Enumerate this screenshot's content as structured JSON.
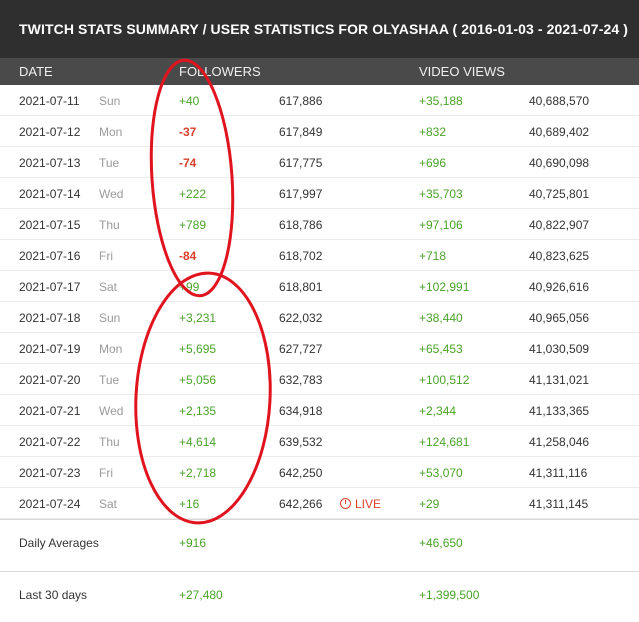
{
  "title": "TWITCH STATS SUMMARY / USER STATISTICS FOR OLYASHAA ( 2016-01-03 - 2021-07-24 )",
  "headers": {
    "date": "DATE",
    "followers": "FOLLOWERS",
    "video_views": "VIDEO VIEWS"
  },
  "rows": [
    {
      "date": "2021-07-11",
      "day": "Sun",
      "followers_change": "+40",
      "followers_total": "617,886",
      "views_change": "+35,188",
      "views_total": "40,688,570"
    },
    {
      "date": "2021-07-12",
      "day": "Mon",
      "followers_change": "-37",
      "followers_total": "617,849",
      "views_change": "+832",
      "views_total": "40,689,402"
    },
    {
      "date": "2021-07-13",
      "day": "Tue",
      "followers_change": "-74",
      "followers_total": "617,775",
      "views_change": "+696",
      "views_total": "40,690,098"
    },
    {
      "date": "2021-07-14",
      "day": "Wed",
      "followers_change": "+222",
      "followers_total": "617,997",
      "views_change": "+35,703",
      "views_total": "40,725,801"
    },
    {
      "date": "2021-07-15",
      "day": "Thu",
      "followers_change": "+789",
      "followers_total": "618,786",
      "views_change": "+97,106",
      "views_total": "40,822,907"
    },
    {
      "date": "2021-07-16",
      "day": "Fri",
      "followers_change": "-84",
      "followers_total": "618,702",
      "views_change": "+718",
      "views_total": "40,823,625"
    },
    {
      "date": "2021-07-17",
      "day": "Sat",
      "followers_change": "+99",
      "followers_total": "618,801",
      "views_change": "+102,991",
      "views_total": "40,926,616"
    },
    {
      "date": "2021-07-18",
      "day": "Sun",
      "followers_change": "+3,231",
      "followers_total": "622,032",
      "views_change": "+38,440",
      "views_total": "40,965,056"
    },
    {
      "date": "2021-07-19",
      "day": "Mon",
      "followers_change": "+5,695",
      "followers_total": "627,727",
      "views_change": "+65,453",
      "views_total": "41,030,509"
    },
    {
      "date": "2021-07-20",
      "day": "Tue",
      "followers_change": "+5,056",
      "followers_total": "632,783",
      "views_change": "+100,512",
      "views_total": "41,131,021"
    },
    {
      "date": "2021-07-21",
      "day": "Wed",
      "followers_change": "+2,135",
      "followers_total": "634,918",
      "views_change": "+2,344",
      "views_total": "41,133,365"
    },
    {
      "date": "2021-07-22",
      "day": "Thu",
      "followers_change": "+4,614",
      "followers_total": "639,532",
      "views_change": "+124,681",
      "views_total": "41,258,046"
    },
    {
      "date": "2021-07-23",
      "day": "Fri",
      "followers_change": "+2,718",
      "followers_total": "642,250",
      "views_change": "+53,070",
      "views_total": "41,311,116"
    },
    {
      "date": "2021-07-24",
      "day": "Sat",
      "followers_change": "+16",
      "followers_total": "642,266",
      "views_change": "+29",
      "views_total": "41,311,145",
      "live": "LIVE"
    }
  ],
  "daily_averages": {
    "label": "Daily Averages",
    "followers": "+916",
    "video_views": "+46,650"
  },
  "last_30_days": {
    "label": "Last 30 days",
    "followers": "+27,480",
    "video_views": "+1,399,500"
  },
  "colors": {
    "positive": "#4aa32a",
    "negative": "#d9412d",
    "live": "#d9412d",
    "annotation": "#e0141e",
    "title_bg": "#2f2f2f",
    "header_bg": "#4a4a4a"
  },
  "icons": {
    "live": "clock-icon"
  }
}
